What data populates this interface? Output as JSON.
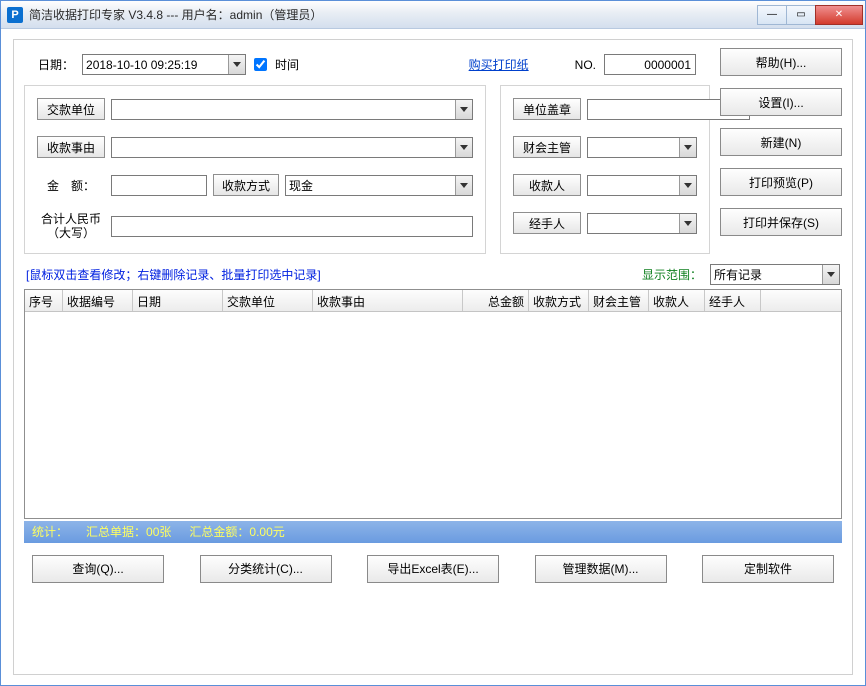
{
  "titlebar": {
    "icon_letter": "P",
    "title": "简洁收据打印专家 V3.4.8 --- 用户名：admin（管理员）"
  },
  "dateRow": {
    "date_label": "日期：",
    "date_value": "2018-10-10 09:25:19",
    "time_checkbox_label": "时间",
    "buy_paper_link": "购买打印纸",
    "no_label": "NO.",
    "no_value": "0000001"
  },
  "leftForm": {
    "payer_btn": "交款单位",
    "payer_value": "",
    "reason_btn": "收款事由",
    "reason_value": "",
    "amount_label": "金　额：",
    "amount_value": "",
    "pay_method_btn": "收款方式",
    "pay_method_value": "现金",
    "amount_cn_label1": "合计人民币",
    "amount_cn_label2": "（大写）",
    "amount_cn_value": ""
  },
  "rightForm": {
    "stamp_btn": "单位盖章",
    "stamp_value": "",
    "manager_btn": "财会主管",
    "manager_value": "",
    "cashier_btn": "收款人",
    "cashier_value": "",
    "handler_btn": "经手人",
    "handler_value": ""
  },
  "sideButtons": {
    "help": "帮助(H)...",
    "settings": "设置(I)...",
    "new": "新建(N)",
    "preview": "打印预览(P)",
    "print_save": "打印并保存(S)"
  },
  "hintRow": {
    "hint": "[鼠标双击查看修改；右键删除记录、批量打印选中记录]",
    "scope_label": "显示范围：",
    "scope_value": "所有记录"
  },
  "table": {
    "columns": [
      "序号",
      "收据编号",
      "日期",
      "交款单位",
      "收款事由",
      "总金额",
      "收款方式",
      "财会主管",
      "收款人",
      "经手人"
    ],
    "widths": [
      38,
      70,
      90,
      90,
      150,
      66,
      60,
      60,
      56,
      56
    ]
  },
  "stats": {
    "label": "统计：",
    "count_label": "汇总单据：",
    "count_value": "00张",
    "sum_label": "汇总金额：",
    "sum_value": "0.00元"
  },
  "bottomButtons": {
    "query": "查询(Q)...",
    "category": "分类统计(C)...",
    "export": "导出Excel表(E)...",
    "manage": "管理数据(M)...",
    "custom": "定制软件"
  }
}
